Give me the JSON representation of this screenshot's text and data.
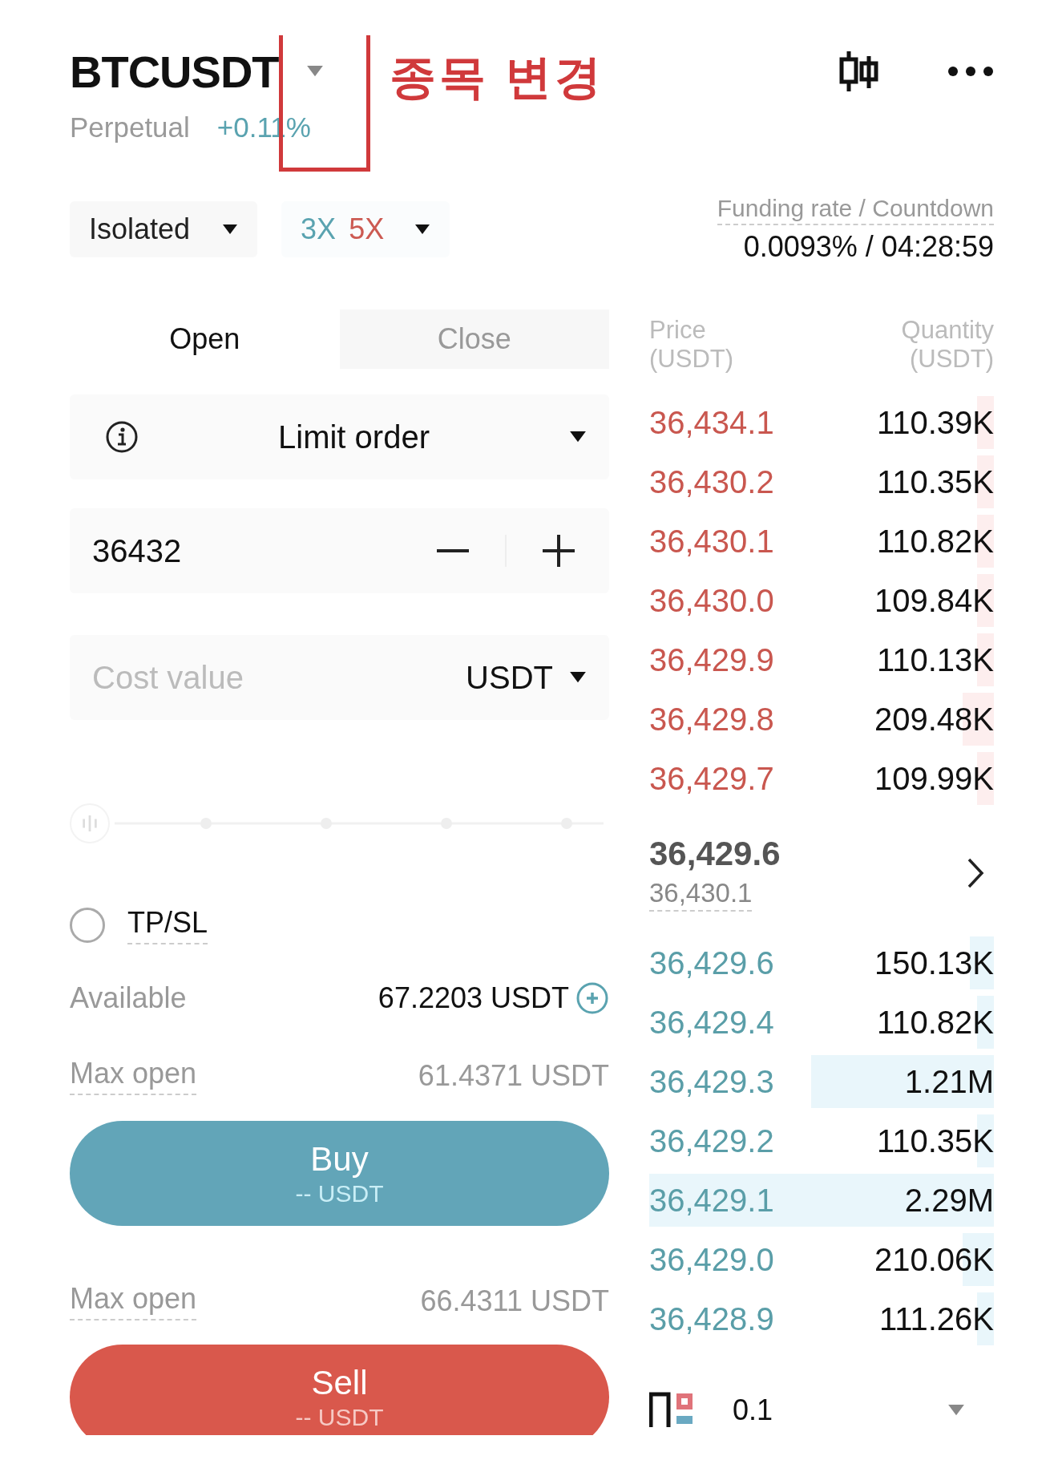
{
  "header": {
    "symbol": "BTCUSDT",
    "contract": "Perpetual",
    "change": "+0.11%"
  },
  "annotation": {
    "text": "종목 변경"
  },
  "margin_mode": {
    "label": "Isolated"
  },
  "leverage": [
    {
      "kind": "long",
      "label": "3X"
    },
    {
      "kind": "short",
      "label": "5X"
    }
  ],
  "funding": {
    "label": "Funding rate / Countdown",
    "value": "0.0093% / 04:28:59"
  },
  "tabs": [
    {
      "label": "Open",
      "selected": true
    },
    {
      "label": "Close",
      "selected": false
    }
  ],
  "order_type": {
    "label": "Limit order"
  },
  "price": {
    "value": "36432"
  },
  "amount": {
    "placeholder": "Cost value",
    "unit": "USDT"
  },
  "slider": {
    "level": 0
  },
  "tpsl": {
    "label": "TP/SL",
    "checked": false
  },
  "available": {
    "label": "Available",
    "value": "67.2203 USDT"
  },
  "sides": [
    {
      "kind": "buy",
      "max_label": "Max open",
      "max_value": "61.4371 USDT",
      "label": "Buy",
      "amount": "-- USDT"
    },
    {
      "kind": "sell",
      "max_label": "Max open",
      "max_value": "66.4311 USDT",
      "label": "Sell",
      "amount": "-- USDT"
    }
  ],
  "order_book": {
    "columns": [
      {
        "title": "Price",
        "unit": "(USDT)"
      },
      {
        "title": "Quantity",
        "unit": "(USDT)"
      }
    ],
    "asks": [
      {
        "price": "36,434.1",
        "quantity": "110.39K"
      },
      {
        "price": "36,430.2",
        "quantity": "110.35K"
      },
      {
        "price": "36,430.1",
        "quantity": "110.82K"
      },
      {
        "price": "36,430.0",
        "quantity": "109.84K"
      },
      {
        "price": "36,429.9",
        "quantity": "110.13K"
      },
      {
        "price": "36,429.8",
        "quantity": "209.48K"
      },
      {
        "price": "36,429.7",
        "quantity": "109.99K"
      }
    ],
    "last_price": "36,429.6",
    "mark_price": "36,430.1",
    "bids": [
      {
        "price": "36,429.6",
        "quantity": "150.13K"
      },
      {
        "price": "36,429.4",
        "quantity": "110.82K"
      },
      {
        "price": "36,429.3",
        "quantity": "1.21M"
      },
      {
        "price": "36,429.2",
        "quantity": "110.35K"
      },
      {
        "price": "36,429.1",
        "quantity": "2.29M"
      },
      {
        "price": "36,429.0",
        "quantity": "210.06K"
      },
      {
        "price": "36,428.9",
        "quantity": "111.26K"
      }
    ],
    "precision": "0.1"
  }
}
